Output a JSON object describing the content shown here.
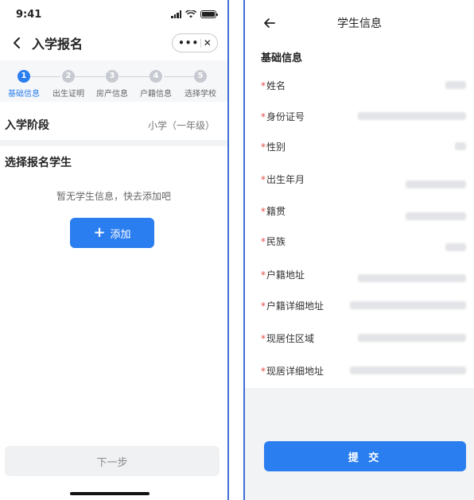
{
  "left": {
    "status": {
      "time": "9:41"
    },
    "nav": {
      "title": "入学报名"
    },
    "steps": [
      {
        "num": "1",
        "label": "基础信息",
        "active": true
      },
      {
        "num": "2",
        "label": "出生证明",
        "active": false
      },
      {
        "num": "3",
        "label": "房产信息",
        "active": false
      },
      {
        "num": "4",
        "label": "户籍信息",
        "active": false
      },
      {
        "num": "5",
        "label": "选择学校",
        "active": false
      }
    ],
    "stage": {
      "label": "入学阶段",
      "value": "小学（一年级）"
    },
    "choose_title": "选择报名学生",
    "empty_hint": "暂无学生信息，快去添加吧",
    "add_button": "添加",
    "next_button": "下一步"
  },
  "right": {
    "nav": {
      "title": "学生信息"
    },
    "section_title": "基础信息",
    "required_mark": "*",
    "fields": [
      {
        "label": "姓名"
      },
      {
        "label": "身份证号"
      },
      {
        "label": "性别"
      },
      {
        "label": "出生年月"
      },
      {
        "label": "籍贯"
      },
      {
        "label": "民族"
      },
      {
        "label": "户籍地址"
      },
      {
        "label": "户籍详细地址"
      },
      {
        "label": "现居住区域"
      },
      {
        "label": "现居详细地址"
      }
    ],
    "submit_button": "提 交"
  },
  "colors": {
    "primary": "#2b7ef0",
    "required": "#e34b4b",
    "divider": "#3f6ed6"
  }
}
